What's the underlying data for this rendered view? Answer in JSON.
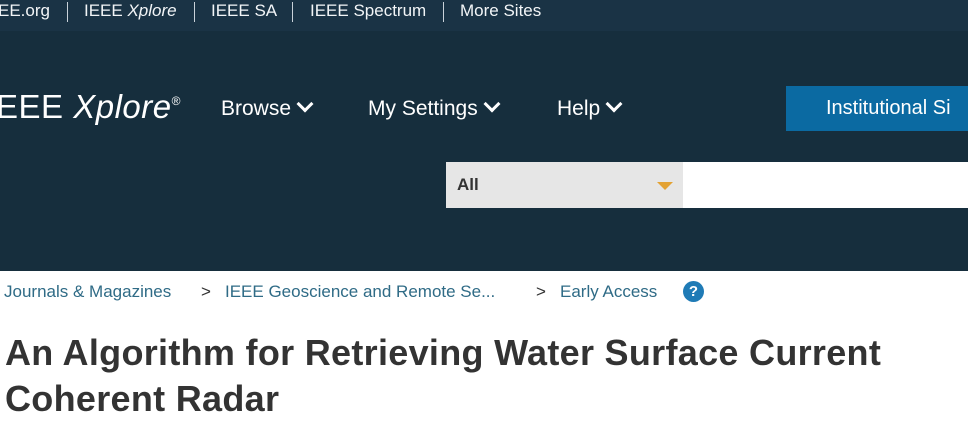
{
  "topbar": {
    "links": [
      "EE.org",
      "IEEE ",
      "Xplore",
      "IEEE SA",
      "IEEE Spectrum",
      "More Sites"
    ]
  },
  "header": {
    "brand_left": "EEE ",
    "brand_right": "Xplore",
    "brand_mark": "®",
    "nav": [
      "Browse",
      "My Settings",
      "Help"
    ],
    "institutional_button": "Institutional Si"
  },
  "search": {
    "scope_value": "All",
    "input_value": "",
    "input_placeholder": ""
  },
  "breadcrumb": {
    "items": [
      "Journals & Magazines",
      "IEEE Geoscience and Remote Se...",
      "Early Access"
    ],
    "separator": ">",
    "help_glyph": "?"
  },
  "article": {
    "title_line1": "An Algorithm for Retrieving Water Surface Current",
    "title_line2": "Coherent Radar"
  },
  "colors": {
    "topbar_bg": "#1a3345",
    "header_bg": "#162e3d",
    "accent_blue": "#0b6aa2",
    "link_blue": "#2f6b86",
    "caret_orange": "#e3a233"
  }
}
